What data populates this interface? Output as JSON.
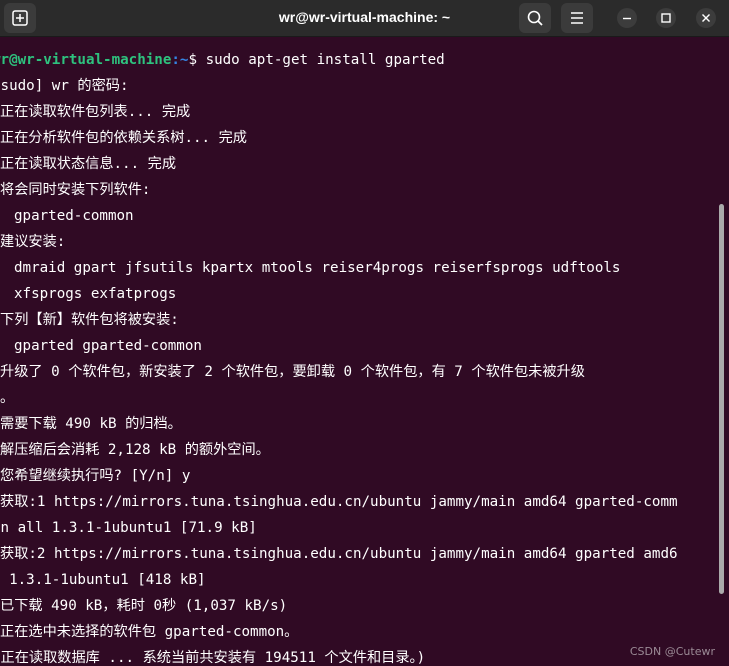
{
  "window": {
    "title": "wr@wr-virtual-machine: ~"
  },
  "prompt": {
    "user_host": "wr@wr-virtual-machine",
    "path": ":~",
    "symbol": "$ ",
    "command": "sudo apt-get install gparted"
  },
  "output": [
    "[sudo] wr 的密码:",
    "正在读取软件包列表... 完成",
    "正在分析软件包的依赖关系树... 完成",
    "正在读取状态信息... 完成",
    "将会同时安装下列软件:",
    "gparted-common",
    "建议安装:",
    "dmraid gpart jfsutils kpartx mtools reiser4progs reiserfsprogs udftools",
    "xfsprogs exfatprogs",
    "下列【新】软件包将被安装:",
    "gparted gparted-common",
    "升级了 0 个软件包，新安装了 2 个软件包，要卸载 0 个软件包，有 7 个软件包未被升级",
    "。",
    "需要下载 490 kB 的归档。",
    "解压缩后会消耗 2,128 kB 的额外空间。",
    "您希望继续执行吗? [Y/n] y",
    "获取:1 https://mirrors.tuna.tsinghua.edu.cn/ubuntu jammy/main amd64 gparted-comm",
    "on all 1.3.1-1ubuntu1 [71.9 kB]",
    "获取:2 https://mirrors.tuna.tsinghua.edu.cn/ubuntu jammy/main amd64 gparted amd6",
    "4 1.3.1-1ubuntu1 [418 kB]",
    "已下载 490 kB，耗时 0秒 (1,037 kB/s)",
    "正在选中未选择的软件包 gparted-common。",
    "(正在读取数据库 ... 系统当前共安装有 194511 个文件和目录。)"
  ],
  "watermark": "CSDN @Cutewr",
  "icons": {
    "new_tab": "new-tab-icon",
    "search": "search-icon",
    "menu": "hamburger-menu-icon",
    "minimize": "minimize-icon",
    "maximize": "maximize-icon",
    "close": "close-icon"
  },
  "colors": {
    "background": "#300a24",
    "titlebar": "#2b2b2b",
    "prompt_user": "#2ec27e",
    "prompt_path": "#3584e4",
    "text": "#ffffff"
  }
}
